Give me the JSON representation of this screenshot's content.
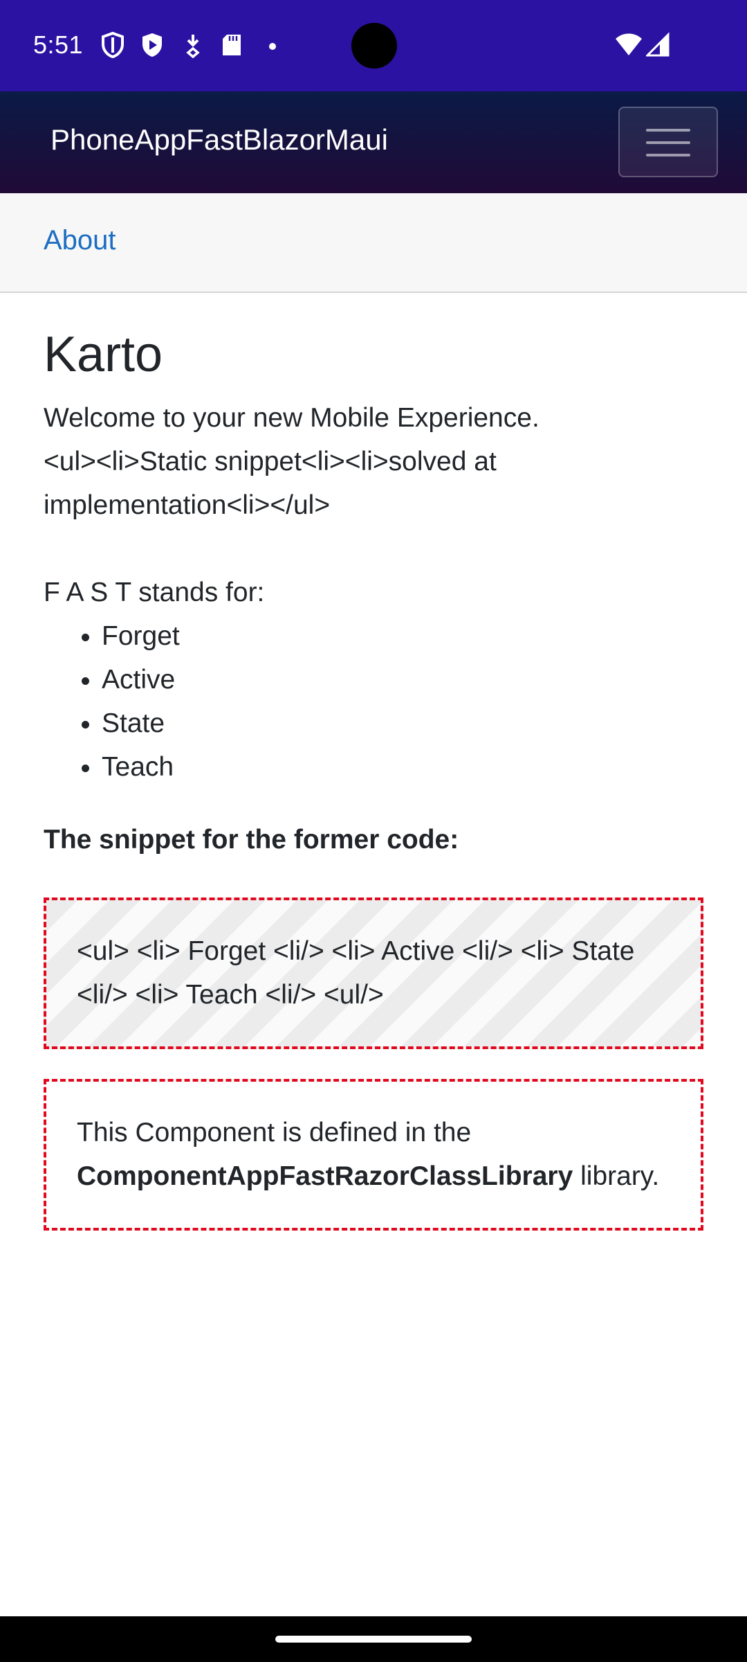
{
  "status_bar": {
    "time": "5:51",
    "icons": [
      "shield-icon",
      "play-shield-icon",
      "download-icon",
      "sd-card-icon",
      "dot-icon",
      "wifi-icon",
      "signal-icon"
    ]
  },
  "header": {
    "title": "PhoneAppFastBlazorMaui",
    "menu_icon": "hamburger-icon"
  },
  "nav": {
    "about_label": "About"
  },
  "main": {
    "heading": "Karto",
    "welcome_line": "Welcome to your new Mobile Experience.",
    "snippet_line": "<ul><li>Static snippet<li><li>solved at implementation<li></ul>",
    "fast_intro": "F A S T stands for:",
    "fast_items": [
      "Forget",
      "Active",
      "State",
      "Teach"
    ],
    "snippet_heading": "The snippet for the former code:",
    "code_text": "<ul> <li> Forget <li/> <li> Active <li/> <li> State <li/> <li> Teach <li/> <ul/>",
    "info_prefix": "This Component is defined in the ",
    "info_library": "ComponentAppFastRazorClassLibrary",
    "info_suffix": " library."
  },
  "colors": {
    "status_bar": "#2c12a2",
    "link": "#1b6ec2",
    "dashed_border": "#e0091d"
  }
}
